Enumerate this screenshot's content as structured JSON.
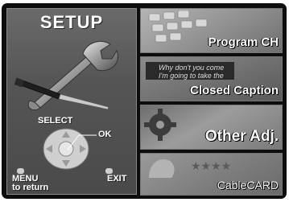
{
  "setup": {
    "title": "SETUP",
    "select_label": "SELECT",
    "ok_label": "OK",
    "menu_label": "MENU",
    "menu_sub_label": "to return",
    "exit_label": "EXIT"
  },
  "menu_items": [
    {
      "label": "Program CH",
      "icon": "remote-keypad-icon"
    },
    {
      "label": "Closed Caption",
      "icon": "caption-text-icon"
    },
    {
      "label": "Other Adj.",
      "icon": "gear-icon"
    },
    {
      "label": "CableCARD",
      "icon": "cablecard-icon"
    }
  ],
  "caption_sample": {
    "line1": "Why don't you come",
    "line2": "I'm going to take the"
  },
  "colors": {
    "screen_bg": "#0d0d0d",
    "tile_bg": "#8a8a8a",
    "text": "#ffffff"
  }
}
